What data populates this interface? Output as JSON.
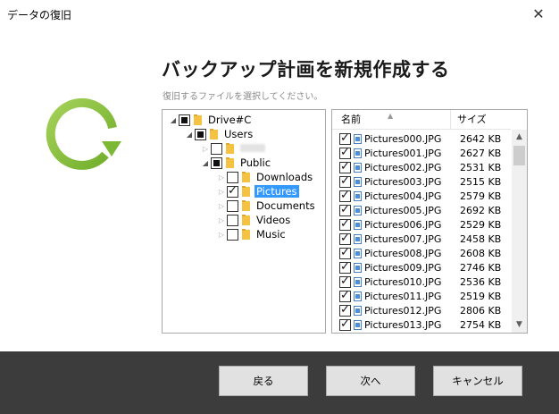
{
  "window": {
    "title": "データの復旧",
    "close_icon": "close-icon"
  },
  "header": {
    "title": "バックアップ計画を新規作成する",
    "subtitle": "復旧するファイルを選択してください。"
  },
  "colors": {
    "logo_green": "#8cc63f",
    "selection": "#3399ff",
    "footer_bg": "#3c3c3c",
    "folder": "#f5c242"
  },
  "tree": {
    "items": [
      {
        "label": "Drive#C",
        "level": 0,
        "expanded": true,
        "state": "partial",
        "has_arrow": true
      },
      {
        "label": "Users",
        "level": 1,
        "expanded": true,
        "state": "partial",
        "has_arrow": true
      },
      {
        "label": "",
        "level": 2,
        "expanded": false,
        "state": "unchecked",
        "has_arrow": true,
        "blurred": true
      },
      {
        "label": "Public",
        "level": 2,
        "expanded": true,
        "state": "partial",
        "has_arrow": true
      },
      {
        "label": "Downloads",
        "level": 3,
        "expanded": false,
        "state": "unchecked",
        "has_arrow": true
      },
      {
        "label": "Pictures",
        "level": 3,
        "expanded": false,
        "state": "checked",
        "has_arrow": true,
        "selected": true
      },
      {
        "label": "Documents",
        "level": 3,
        "expanded": false,
        "state": "unchecked",
        "has_arrow": true
      },
      {
        "label": "Videos",
        "level": 3,
        "expanded": false,
        "state": "unchecked",
        "has_arrow": true
      },
      {
        "label": "Music",
        "level": 3,
        "expanded": false,
        "state": "unchecked",
        "has_arrow": true
      }
    ]
  },
  "filelist": {
    "columns": {
      "name": "名前",
      "size": "サイズ"
    },
    "files": [
      {
        "name": "Pictures000.JPG",
        "size": "2642 KB",
        "checked": true
      },
      {
        "name": "Pictures001.JPG",
        "size": "2627 KB",
        "checked": true
      },
      {
        "name": "Pictures002.JPG",
        "size": "2531 KB",
        "checked": true
      },
      {
        "name": "Pictures003.JPG",
        "size": "2515 KB",
        "checked": true
      },
      {
        "name": "Pictures004.JPG",
        "size": "2579 KB",
        "checked": true
      },
      {
        "name": "Pictures005.JPG",
        "size": "2692 KB",
        "checked": true
      },
      {
        "name": "Pictures006.JPG",
        "size": "2529 KB",
        "checked": true
      },
      {
        "name": "Pictures007.JPG",
        "size": "2458 KB",
        "checked": true
      },
      {
        "name": "Pictures008.JPG",
        "size": "2608 KB",
        "checked": true
      },
      {
        "name": "Pictures009.JPG",
        "size": "2746 KB",
        "checked": true
      },
      {
        "name": "Pictures010.JPG",
        "size": "2536 KB",
        "checked": true
      },
      {
        "name": "Pictures011.JPG",
        "size": "2519 KB",
        "checked": true
      },
      {
        "name": "Pictures012.JPG",
        "size": "2806 KB",
        "checked": true
      },
      {
        "name": "Pictures013.JPG",
        "size": "2754 KB",
        "checked": true
      }
    ]
  },
  "footer": {
    "back_label": "戻る",
    "next_label": "次へ",
    "cancel_label": "キャンセル"
  }
}
